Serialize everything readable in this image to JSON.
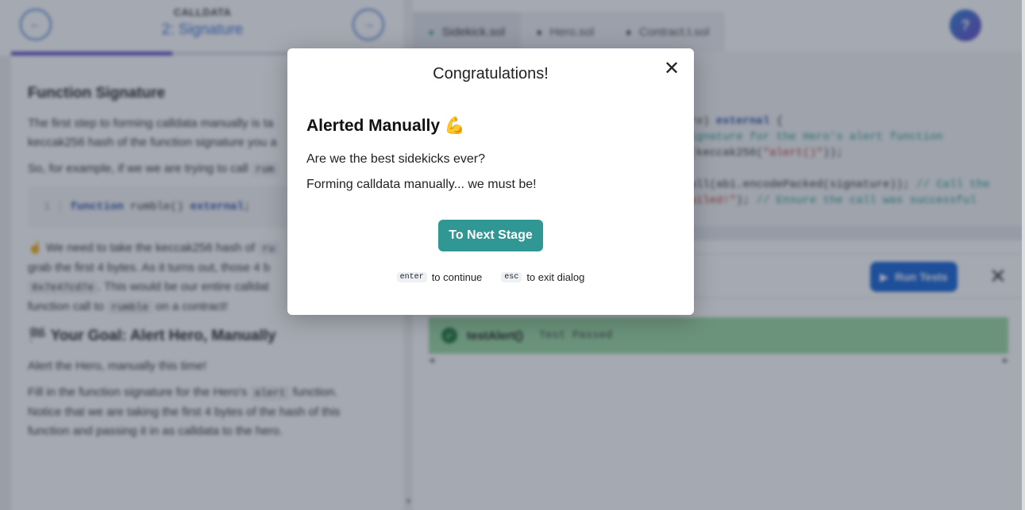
{
  "stage": {
    "overline": "CALLDATA",
    "title": "2: Signature",
    "progress_fraction": 0.41
  },
  "lesson": {
    "heading": "Function Signature",
    "p1": "The first step to forming calldata manually is ta",
    "p1b": "keccak256 hash of the function signature you a",
    "p2_prefix": "So, for example, if we we are trying to call",
    "p2_code": "rum",
    "code_line_no": "1",
    "code_kw1": "function",
    "code_mid": " rumble() ",
    "code_kw2": "external",
    "code_end": ";",
    "p3_emoji": "☝️",
    "p3_a": "We need to take the keccak256 hash of",
    "p3_code1": "ru",
    "p3_b": "grab the first 4 bytes. As it turns out, those 4 b",
    "p3_code2": "0x7e47cd7e",
    "p3_c": ". This would be our entire calldat",
    "p3_d": "function call to",
    "p3_code3": "rumble",
    "p3_e": "on a contract!",
    "goal_emoji": "🏁",
    "goal_heading": "Your Goal: Alert Hero, Manually",
    "g1": "Alert the Hero, manually this time!",
    "g2_a": "Fill in the function signature for the Hero's",
    "g2_code": "alert",
    "g2_b": "function.",
    "g3": "Notice that we are taking the first 4 bytes of the hash of this",
    "g4": "function and passing it in as calldata to the hero."
  },
  "tabs": [
    {
      "label": "Sidekick.sol"
    },
    {
      "label": "Hero.sol"
    },
    {
      "label": "Contract.t.sol"
    }
  ],
  "help_label": "?",
  "editor": {
    "l1a": "ero) ",
    "l1b": "external",
    "l1c": " {",
    "l2": "signature for the Hero's alert function",
    "l3a": "4(keccak256(",
    "l3b": "\"alert()\"",
    "l3c": "));",
    "l4a": "call(abi.encodePacked(signature)); ",
    "l4b": "// Call the",
    "l5a": "failed!\"",
    "l5b": "); ",
    "l5c": "// Ensure the call was successful"
  },
  "tests": {
    "run_label": "Run Tests",
    "close_glyph": "✕",
    "result_name": "testAlert()",
    "result_status": "Test Passed"
  },
  "modal": {
    "title": "Congratulations!",
    "close_glyph": "✕",
    "heading": "Alerted Manually",
    "heading_emoji": "💪",
    "line1": "Are we the best sidekicks ever?",
    "line2": "Forming calldata manually... we must be!",
    "button": "To Next Stage",
    "hint1_key": "enter",
    "hint1_text": "to continue",
    "hint2_key": "esc",
    "hint2_text": "to exit dialog"
  },
  "colors": {
    "accent": "#319795",
    "run": "#1864d8",
    "pass": "#9bd9a2"
  }
}
